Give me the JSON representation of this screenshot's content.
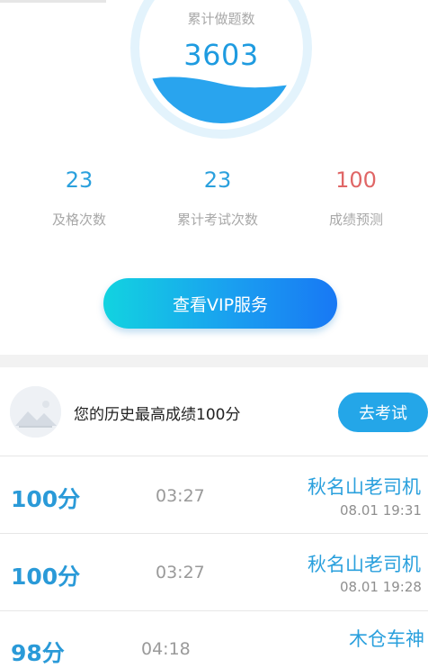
{
  "summary": {
    "label": "累计做题数",
    "total": "3603",
    "fill": 0.55
  },
  "stats": [
    {
      "value": "23",
      "label": "及格次数",
      "color": "#2aa0dd"
    },
    {
      "value": "23",
      "label": "累计考试次数",
      "color": "#2aa0dd"
    },
    {
      "value": "100",
      "label": "成绩预测",
      "color": "#e06666"
    }
  ],
  "vip_button": "查看VIP服务",
  "best": {
    "text": "您的历史最高成绩100分",
    "button": "去考试"
  },
  "records": [
    {
      "score": "100分",
      "duration": "03:27",
      "name": "秋名山老司机",
      "date": "08.01  19:31"
    },
    {
      "score": "100分",
      "duration": "03:27",
      "name": "秋名山老司机",
      "date": "08.01  19:28"
    },
    {
      "score": "98分",
      "duration": "04:18",
      "name": "木仓车神",
      "date": ""
    }
  ],
  "colors": {
    "accent": "#2aa0dd",
    "wave": "#29a4ee",
    "ring": "#e6f4fc",
    "prediction": "#e06666"
  }
}
